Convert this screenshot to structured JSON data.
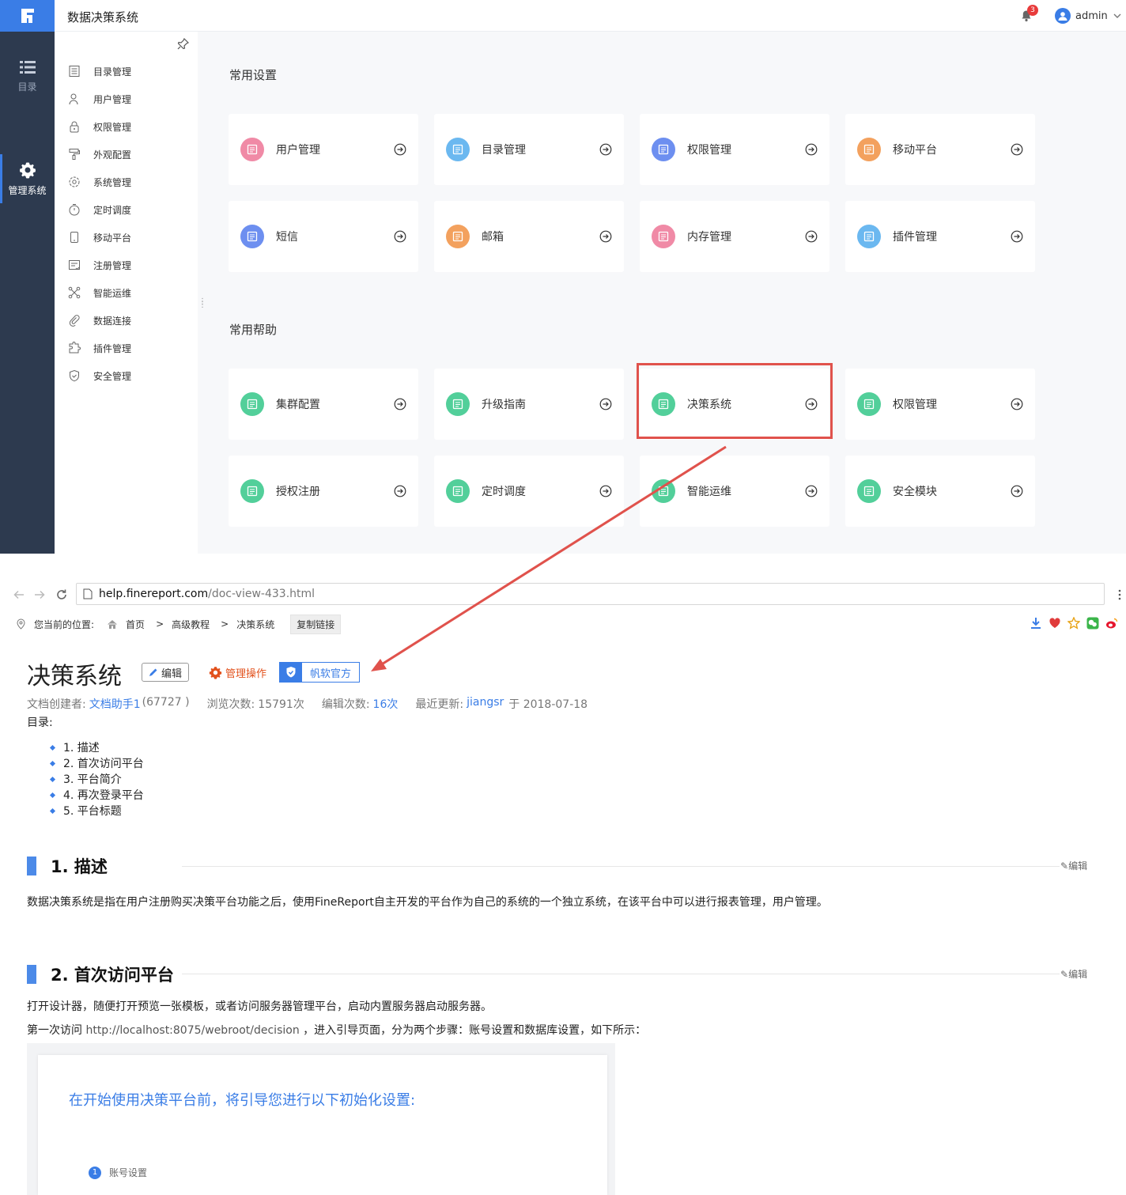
{
  "app": {
    "title": "数据决策系统",
    "notification_count": "3",
    "username": "admin"
  },
  "left_nav": [
    {
      "label": "目录",
      "icon": "list-icon",
      "active": false
    },
    {
      "label": "管理系统",
      "icon": "gear-icon",
      "active": true
    }
  ],
  "sub_nav": [
    {
      "label": "目录管理",
      "icon": "catalog-icon"
    },
    {
      "label": "用户管理",
      "icon": "user-icon"
    },
    {
      "label": "权限管理",
      "icon": "lock-icon"
    },
    {
      "label": "外观配置",
      "icon": "paint-roller-icon"
    },
    {
      "label": "系统管理",
      "icon": "settings-icon"
    },
    {
      "label": "定时调度",
      "icon": "timer-icon"
    },
    {
      "label": "移动平台",
      "icon": "mobile-icon"
    },
    {
      "label": "注册管理",
      "icon": "register-icon"
    },
    {
      "label": "智能运维",
      "icon": "network-icon"
    },
    {
      "label": "数据连接",
      "icon": "link-icon"
    },
    {
      "label": "插件管理",
      "icon": "puzzle-icon"
    },
    {
      "label": "安全管理",
      "icon": "shield-icon"
    }
  ],
  "common_settings": {
    "title": "常用设置",
    "cards": [
      {
        "label": "用户管理",
        "color": "#f08aa6"
      },
      {
        "label": "目录管理",
        "color": "#6bb8f0"
      },
      {
        "label": "权限管理",
        "color": "#6d8ff0"
      },
      {
        "label": "移动平台",
        "color": "#f3a15e"
      },
      {
        "label": "短信",
        "color": "#6d8ff0"
      },
      {
        "label": "邮箱",
        "color": "#f3a15e"
      },
      {
        "label": "内存管理",
        "color": "#f08aa6"
      },
      {
        "label": "插件管理",
        "color": "#6bb8f0"
      }
    ]
  },
  "common_help": {
    "title": "常用帮助",
    "cards": [
      {
        "label": "集群配置",
        "color": "#52cf9a"
      },
      {
        "label": "升级指南",
        "color": "#52cf9a"
      },
      {
        "label": "决策系统",
        "color": "#52cf9a"
      },
      {
        "label": "权限管理",
        "color": "#52cf9a"
      },
      {
        "label": "授权注册",
        "color": "#52cf9a"
      },
      {
        "label": "定时调度",
        "color": "#52cf9a"
      },
      {
        "label": "智能运维",
        "color": "#52cf9a"
      },
      {
        "label": "安全模块",
        "color": "#52cf9a"
      }
    ]
  },
  "browser": {
    "url_host": "help.finereport.com",
    "url_path": "/doc-view-433.html"
  },
  "breadcrumb": {
    "prefix": "您当前的位置:",
    "items": [
      "首页",
      "高级教程",
      "决策系统"
    ],
    "separator": ">",
    "copy_link": "复制链接"
  },
  "doc": {
    "title": "决策系统",
    "edit_label": "编辑",
    "admin_label": "管理操作",
    "official_label": "帆软官方",
    "meta": {
      "creator_label": "文档创建者:",
      "creator": "文档助手1",
      "creator_id": "(67727 )",
      "views_label": "浏览次数:",
      "views": "15791次",
      "edits_label": "编辑次数:",
      "edits": "16次",
      "updated_label": "最近更新:",
      "updated_by": "jiangsr",
      "updated_on": "于 2018-07-18"
    },
    "toc_label": "目录:",
    "toc": [
      "1. 描述",
      "2. 首次访问平台",
      "3. 平台简介",
      "4. 再次登录平台",
      "5. 平台标题"
    ],
    "section1": {
      "heading": "1. 描述",
      "edit": "编辑",
      "text": "数据决策系统是指在用户注册购买决策平台功能之后，使用FineReport自主开发的平台作为自己的系统的一个独立系统，在该平台中可以进行报表管理，用户管理。"
    },
    "section2": {
      "heading": "2. 首次访问平台",
      "edit": "编辑",
      "text1": "打开设计器，随便打开预览一张模板，或者访问服务器管理平台，启动内置服务器启动服务器。",
      "text2_prefix": "第一次访问",
      "text2_url": "http://localhost:8075/webroot/decision",
      "text2_suffix": "，进入引导页面，分为两个步骤：账号设置和数据库设置，如下所示：",
      "shot_title": "在开始使用决策平台前，将引导您进行以下初始化设置:",
      "step_num": "1",
      "step_label": "账号设置"
    }
  }
}
